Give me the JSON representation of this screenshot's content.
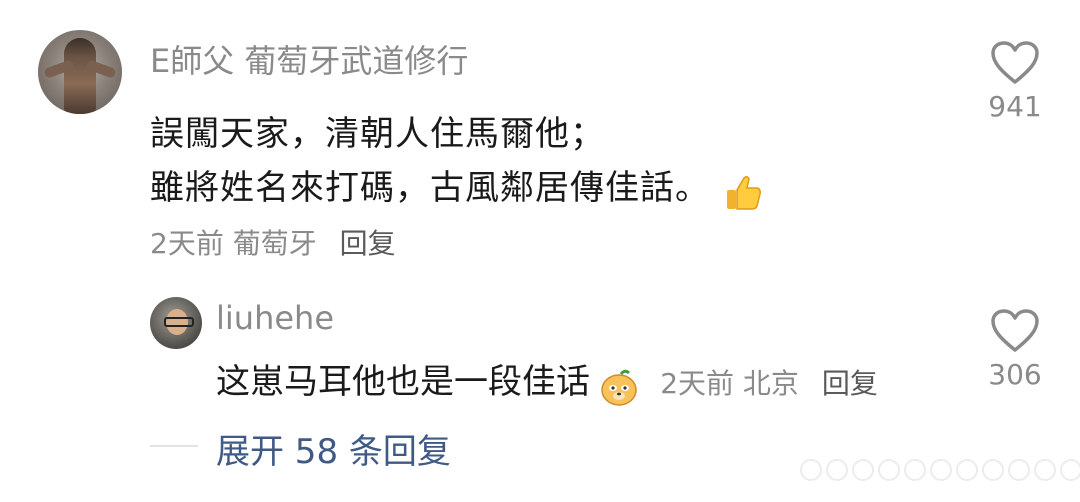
{
  "comment": {
    "username": "E師父 葡萄牙武道修行",
    "lines": [
      "誤闖天家，清朝人住馬爾他；",
      "雖將姓名來打碼，古風鄰居傳佳話。"
    ],
    "time": "2天前",
    "location": "葡萄牙",
    "reply_label": "回复",
    "like_count": "941",
    "emoji": "thumbs-up-icon"
  },
  "reply": {
    "username": "liuhehe",
    "text": "这崽马耳他也是一段佳话",
    "time": "2天前",
    "location": "北京",
    "reply_label": "回复",
    "like_count": "306",
    "emoji": "doge-face-icon"
  },
  "expand": {
    "label": "展开 58 条回复"
  },
  "colors": {
    "meta_gray": "#8a8a8a",
    "link_blue": "#3f5a86",
    "text": "#1a1a1a"
  }
}
